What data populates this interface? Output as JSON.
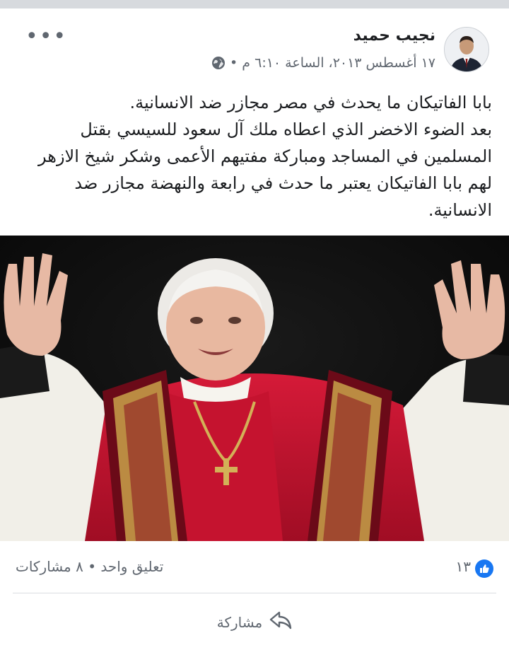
{
  "post": {
    "author": "نجيب حميد",
    "meta_text": "١٧ أغسطس ٢٠١٣، الساعة ٦:١٠ م •",
    "icons": {
      "privacy": "globe-icon",
      "more": "more-options-icon"
    },
    "text_lines": [
      "بابا الفاتيكان ما يحدث في مصر مجازر ضد الانسانية.",
      "بعد الضوء الاخضر الذي اعطاه ملك آل سعود للسيسي بقتل",
      "المسلمين في المساجد ومباركة مفتيهم الأعمى وشكر شيخ الازهر",
      "لهم بابا الفاتيكان يعتبر ما حدث في رابعة والنهضة مجازر ضد",
      "الانسانية."
    ]
  },
  "stats": {
    "likes": "١٣",
    "comments_shares": "تعليق واحد • ٨ مشاركات"
  },
  "actions": {
    "share_label": "مشاركة"
  },
  "colors": {
    "accent": "#1877f2",
    "robe_red": "#c0102a",
    "gold": "#c9a24a"
  }
}
